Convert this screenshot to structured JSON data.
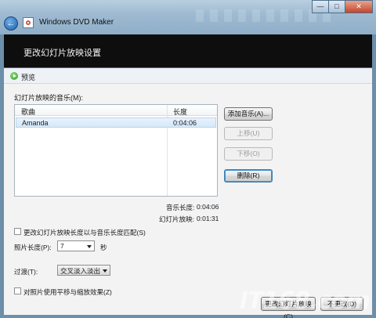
{
  "window": {
    "title": "Windows DVD Maker",
    "back_icon": "back-arrow-icon",
    "controls": {
      "minimize": "—",
      "maximize": "□",
      "close": "✕"
    }
  },
  "header": {
    "title": "更改幻灯片放映设置"
  },
  "preview": {
    "label": "预览",
    "icon": "play-icon"
  },
  "music": {
    "label": "幻灯片放映的音乐(M):",
    "columns": [
      "歌曲",
      "长度"
    ],
    "rows": [
      {
        "song": "Amanda",
        "length": "0:04:06"
      }
    ]
  },
  "buttons": {
    "add_music": "添加音乐(A)...",
    "move_up": "上移(U)",
    "move_down": "下移(O)",
    "remove": "删除(R)"
  },
  "durations": {
    "music_label": "音乐长度:",
    "music_value": "0:04:06",
    "slideshow_label": "幻灯片放映:",
    "slideshow_value": "0:01:31"
  },
  "options": {
    "match_length_label": "更改幻灯片放映长度以与音乐长度匹配(S)",
    "match_length_checked": false,
    "photo_length_label": "照片长度(P):",
    "photo_length_value": "7",
    "photo_length_unit": "秒",
    "transition_label": "过渡(T):",
    "transition_value": "交叉淡入淡出",
    "pan_zoom_label": "对照片使用平移与缩放效果(Z)",
    "pan_zoom_checked": false
  },
  "footer": {
    "change_button": "更改幻灯片放映(C)",
    "cancel_button": "不更改(D)"
  },
  "watermark": "IT168.com"
}
